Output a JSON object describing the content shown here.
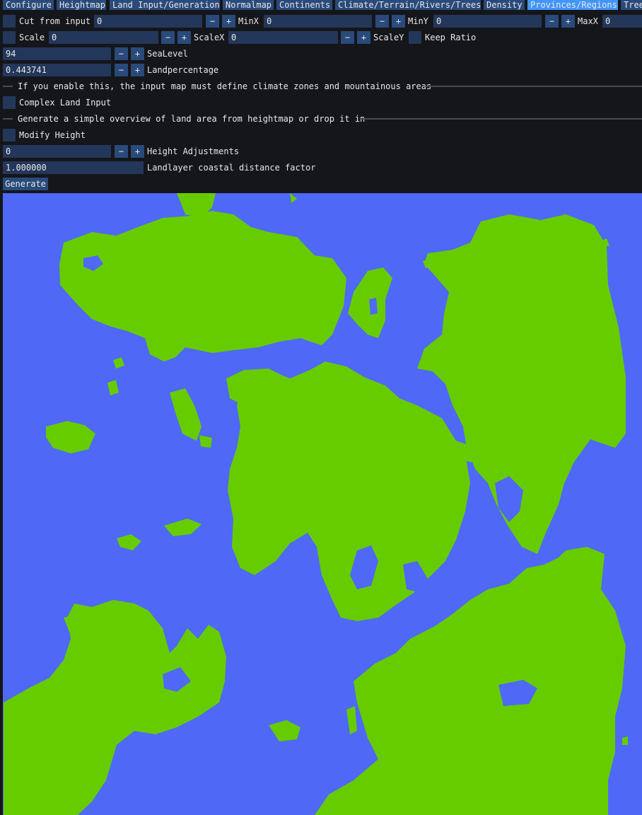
{
  "tabs": [
    "Configure",
    "Heightmap",
    "Land Input/Generation",
    "Normalmap",
    "Continents",
    "Climate/Terrain/Rivers/Trees",
    "Density",
    "Provinces/Regions",
    "Trees"
  ],
  "active_tab_index": 7,
  "row1": {
    "cut_label": "Cut from input",
    "cut_value": "0",
    "minx_label": "MinX",
    "minx_value": "0",
    "miny_label": "MinY",
    "miny_value": "0",
    "maxx_label": "MaxX",
    "maxx_value": "0"
  },
  "row2": {
    "scale_label": "Scale",
    "scale_value": "0",
    "scalex_label": "ScaleX",
    "scalex_value": "0",
    "scaley_label": "ScaleY",
    "keep_ratio_label": "Keep Ratio"
  },
  "sealevel": {
    "value": "94",
    "label": "SeaLevel"
  },
  "landpercentage": {
    "value": "0.443741",
    "label": "Landpercentage"
  },
  "sep1_text": "If you enable this, the input map must define climate zones and mountainous areas",
  "complex_land_input_label": "Complex Land Input",
  "sep2_text": "Generate a simple overview of land area from heightmap or drop it in",
  "modify_height_label": "Modify Height",
  "height_adjustments": {
    "value": "0",
    "label": "Height Adjustments"
  },
  "coastal_factor": {
    "value": "1.000000",
    "label": "Landlayer coastal distance factor"
  },
  "generate_label": "Generate",
  "minus": "−",
  "plus": "+",
  "colors": {
    "water": "#4f68f6",
    "land": "#66cc00",
    "panel": "#15161a",
    "accent": "#294a7a",
    "active_tab": "#4296fa"
  }
}
